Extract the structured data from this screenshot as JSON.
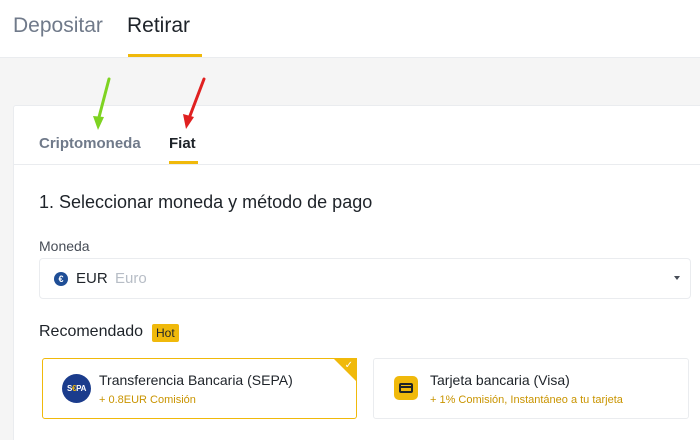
{
  "top_tabs": {
    "deposit": "Depositar",
    "withdraw": "Retirar"
  },
  "sub_tabs": {
    "crypto": "Criptomoneda",
    "fiat": "Fiat"
  },
  "step": {
    "title": "1. Seleccionar moneda y método de pago"
  },
  "currency_field": {
    "label": "Moneda",
    "icon": "euro-icon",
    "selected_code": "EUR",
    "selected_name": "Euro"
  },
  "recommended": {
    "label": "Recomendado",
    "badge": "Hot"
  },
  "methods": [
    {
      "title": "Transferencia Bancaria (SEPA)",
      "subtitle": "+ 0.8EUR Comisión",
      "icon": "sepa-logo",
      "selected": true
    },
    {
      "title": "Tarjeta bancaria (Visa)",
      "subtitle": "+ 1% Comisión, Instantáneo a tu tarjeta",
      "icon": "card-icon",
      "selected": false
    }
  ],
  "sepa_logo_text": {
    "before": "S",
    "highlight": "€",
    "after": "PA"
  },
  "colors": {
    "accent": "#f0b90b",
    "text": "#1e2329",
    "muted": "#707a8a",
    "green_arrow": "#7ed321",
    "red_arrow": "#e02020"
  }
}
